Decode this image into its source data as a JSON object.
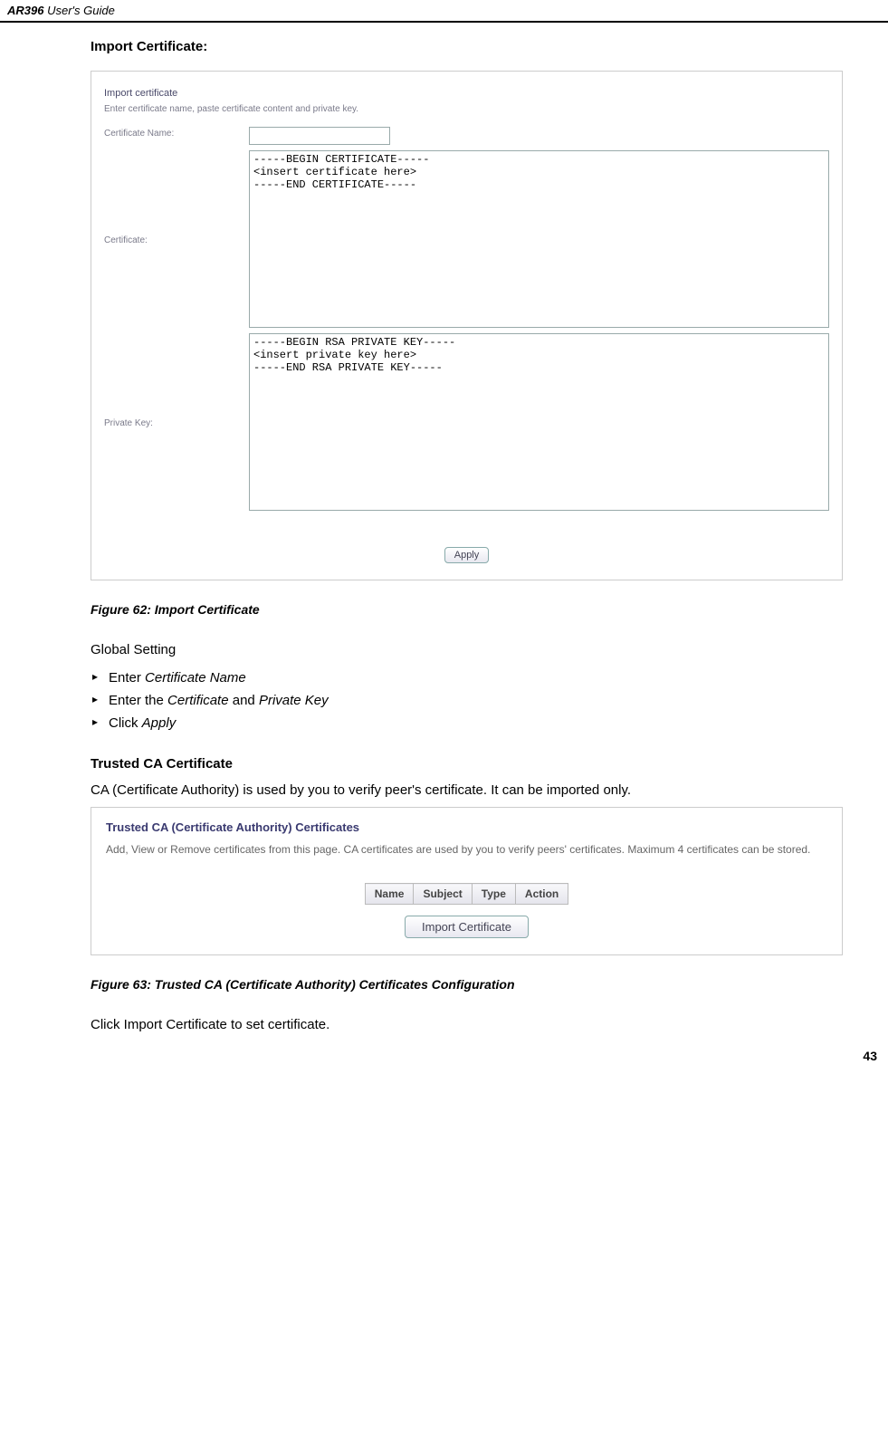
{
  "header": {
    "product": "AR396",
    "guide": "User's Guide"
  },
  "page_number": "43",
  "section_import": {
    "heading": "Import Certificate:",
    "panel_title": "Import certificate",
    "panel_sub": "Enter certificate name, paste certificate content and private key.",
    "label_name": "Certificate Name:",
    "name_value": "",
    "label_cert": "Certificate:",
    "cert_value": "-----BEGIN CERTIFICATE-----\n<insert certificate here>\n-----END CERTIFICATE-----",
    "label_key": "Private Key:",
    "key_value": "-----BEGIN RSA PRIVATE KEY-----\n<insert private key here>\n-----END RSA PRIVATE KEY-----",
    "apply_label": "Apply",
    "figure_caption": "Figure 62: Import Certificate"
  },
  "global_setting": {
    "title": "Global Setting",
    "b1_a": "Enter ",
    "b1_b": "Certificate Name",
    "b2_a": "Enter the ",
    "b2_b": "Certificate",
    "b2_c": " and ",
    "b2_d": "Private Key",
    "b3_a": "Click ",
    "b3_b": "Apply"
  },
  "section_ca": {
    "heading": "Trusted CA Certificate",
    "intro": "CA (Certificate Authority) is used by you to verify peer's certificate. It can be imported only.",
    "panel_title": "Trusted CA (Certificate Authority) Certificates",
    "panel_desc": "Add, View or Remove certificates from this page. CA certificates are used by you to verify peers' certificates. Maximum 4 certificates can be stored.",
    "col_name": "Name",
    "col_subject": "Subject",
    "col_type": "Type",
    "col_action": "Action",
    "import_btn": "Import Certificate",
    "figure_caption": "Figure 63: Trusted CA (Certificate Authority) Certificates Configuration",
    "outro": "Click Import Certificate to set certificate."
  }
}
